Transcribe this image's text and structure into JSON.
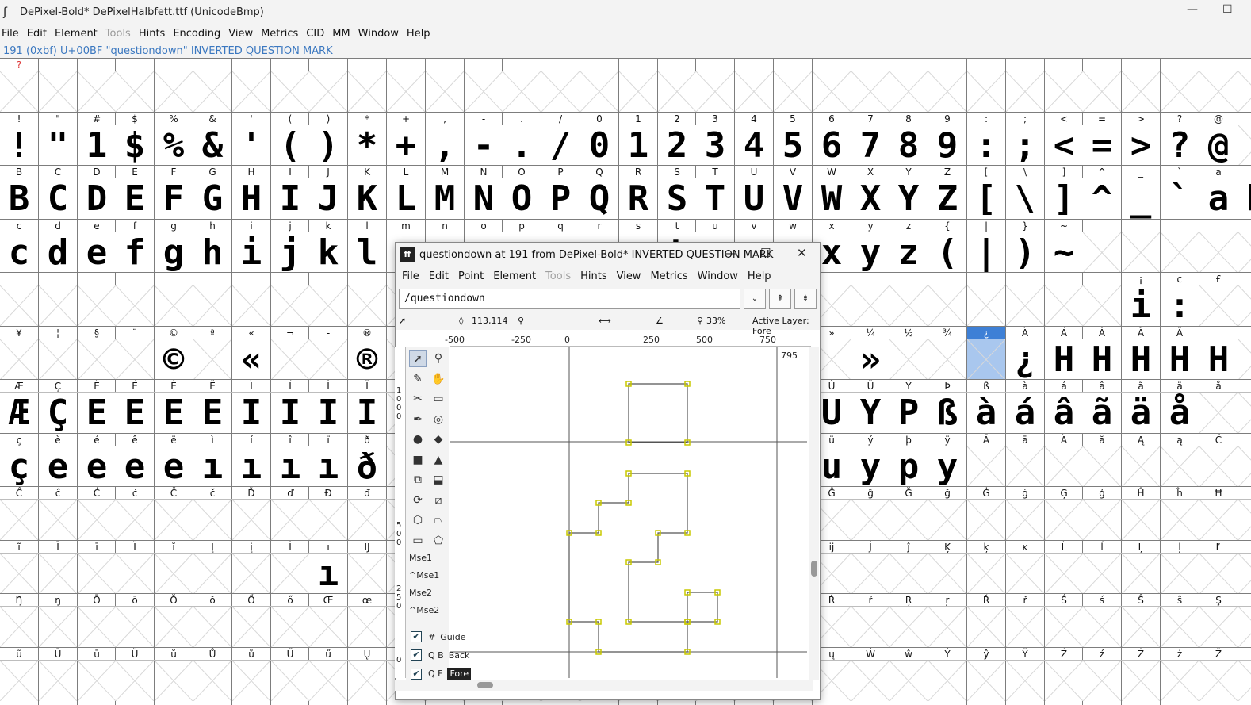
{
  "window": {
    "title": "DePixel-Bold*  DePixelHalbfett.ttf (UnicodeBmp)",
    "app_icon": "fontforge-icon"
  },
  "menu": [
    "File",
    "Edit",
    "Element",
    "Tools",
    "Hints",
    "Encoding",
    "View",
    "Metrics",
    "CID",
    "MM",
    "Window",
    "Help"
  ],
  "menu_disabled": [
    "Tools"
  ],
  "info_line": "191 (0xbf) U+00BF \"questiondown\" INVERTED QUESTION MARK",
  "grid": {
    "rows": [
      {
        "labels": [
          "?",
          "",
          "",
          "",
          "",
          "",
          "",
          "",
          "",
          "",
          "",
          "",
          "",
          "",
          "",
          "",
          "",
          "",
          "",
          "",
          "",
          "",
          "",
          "",
          "",
          "",
          "",
          "",
          "",
          "",
          "",
          "",
          ""
        ],
        "glyphs": [
          "",
          "",
          "",
          "",
          "",
          "",
          "",
          "",
          "",
          "",
          "",
          "",
          "",
          "",
          "",
          "",
          "",
          "",
          "",
          "",
          "",
          "",
          "",
          "",
          "",
          "",
          "",
          "",
          "",
          "",
          "",
          "",
          ""
        ]
      },
      {
        "labels": [
          "!",
          "\"",
          "#",
          "$",
          "%",
          "&",
          "'",
          "(",
          ")",
          "*",
          "+",
          ",",
          "-",
          ".",
          "/",
          "0",
          "1",
          "2",
          "3",
          "4",
          "5",
          "6",
          "7",
          "8",
          "9",
          ":",
          ";",
          "<",
          "=",
          ">",
          "?",
          "@",
          ""
        ],
        "glyphs": [
          "!",
          "\"",
          "1",
          "$",
          "%",
          "&",
          "'",
          "(",
          ")",
          "*",
          "+",
          ",",
          "-",
          ".",
          "/",
          "0",
          "1",
          "2",
          "3",
          "4",
          "5",
          "6",
          "7",
          "8",
          "9",
          ":",
          ";",
          "<",
          "=",
          ">",
          "?",
          "@",
          ""
        ]
      },
      {
        "labels": [
          "B",
          "C",
          "D",
          "E",
          "F",
          "G",
          "H",
          "I",
          "J",
          "K",
          "L",
          "M",
          "N",
          "O",
          "P",
          "Q",
          "R",
          "S",
          "T",
          "U",
          "V",
          "W",
          "X",
          "Y",
          "Z",
          "[",
          "\\",
          "]",
          "^",
          "_",
          "`",
          "a",
          ""
        ],
        "glyphs": [
          "B",
          "C",
          "D",
          "E",
          "F",
          "G",
          "H",
          "I",
          "J",
          "K",
          "L",
          "M",
          "N",
          "O",
          "P",
          "Q",
          "R",
          "S",
          "T",
          "U",
          "V",
          "W",
          "X",
          "Y",
          "Z",
          "[",
          "\\",
          "]",
          "^",
          "_",
          "`",
          "a",
          "b"
        ]
      },
      {
        "labels": [
          "c",
          "d",
          "e",
          "f",
          "g",
          "h",
          "i",
          "j",
          "k",
          "l",
          "m",
          "n",
          "o",
          "p",
          "q",
          "r",
          "s",
          "t",
          "u",
          "v",
          "w",
          "x",
          "y",
          "z",
          "{",
          "|",
          "}",
          "~",
          "",
          "",
          "",
          "",
          ""
        ],
        "glyphs": [
          "c",
          "d",
          "e",
          "f",
          "g",
          "h",
          "i",
          "j",
          "k",
          "l",
          "m",
          "n",
          "o",
          "p",
          "q",
          "r",
          "s",
          "t",
          "u",
          "v",
          "w",
          "x",
          "y",
          "z",
          "(",
          "|",
          ")",
          "~",
          "",
          "",
          "",
          "",
          ""
        ]
      },
      {
        "labels": [
          "",
          "",
          "",
          "",
          "",
          "",
          "",
          "",
          "",
          "",
          "",
          "",
          "",
          "",
          "",
          "",
          "",
          "",
          "",
          "",
          "",
          "",
          "",
          "",
          "",
          "",
          "",
          "",
          "",
          "¡",
          "¢",
          "£",
          ""
        ],
        "glyphs": [
          "",
          "",
          "",
          "",
          "",
          "",
          "",
          "",
          "",
          "",
          "",
          "",
          "",
          "",
          "",
          "",
          "",
          "",
          "",
          "",
          "",
          "",
          "",
          "",
          "",
          "",
          "",
          "",
          "",
          "i",
          ":",
          "",
          ""
        ]
      },
      {
        "labels": [
          "¥",
          "¦",
          "§",
          "¨",
          "©",
          "ª",
          "«",
          "¬",
          "-",
          "®",
          "",
          "",
          "",
          "",
          "",
          "",
          "",
          "",
          "",
          "",
          "",
          "»",
          "¼",
          "½",
          "¾",
          "¿",
          "À",
          "Á",
          "Â",
          "Ã",
          "Ä",
          ""
        ],
        "glyphs": [
          "",
          "",
          "",
          "",
          "©",
          "",
          "«",
          "",
          "",
          "®",
          "",
          "",
          "",
          "",
          "",
          "",
          "",
          "",
          "",
          "",
          "",
          "",
          "»",
          "",
          "",
          "",
          "¿",
          "H",
          "H",
          "H",
          "H",
          "H"
        ]
      },
      {
        "labels": [
          "Æ",
          "Ç",
          "È",
          "É",
          "Ê",
          "Ë",
          "Ì",
          "Í",
          "Î",
          "Ï",
          "",
          "",
          "",
          "",
          "",
          "",
          "",
          "",
          "",
          "",
          "",
          "Û",
          "Ü",
          "Ý",
          "Þ",
          "ß",
          "à",
          "á",
          "â",
          "ã",
          "ä",
          "å"
        ],
        "glyphs": [
          "Æ",
          "Ç",
          "E",
          "E",
          "E",
          "E",
          "I",
          "I",
          "I",
          "I",
          "",
          "",
          "",
          "",
          "",
          "",
          "",
          "",
          "",
          "",
          "",
          "U",
          "Y",
          "P",
          "ß",
          "à",
          "á",
          "â",
          "ã",
          "ä",
          "å",
          ""
        ]
      },
      {
        "labels": [
          "ç",
          "è",
          "é",
          "ê",
          "ë",
          "ì",
          "í",
          "î",
          "ï",
          "ð",
          "",
          "",
          "",
          "",
          "",
          "",
          "",
          "",
          "",
          "",
          "",
          "ü",
          "ý",
          "þ",
          "ÿ",
          "Ā",
          "ā",
          "Ă",
          "ă",
          "Ą",
          "ą",
          "Ć"
        ],
        "glyphs": [
          "ç",
          "e",
          "e",
          "e",
          "e",
          "ı",
          "ı",
          "ı",
          "ı",
          "ð",
          "",
          "",
          "",
          "",
          "",
          "",
          "",
          "",
          "",
          "",
          "",
          "u",
          "y",
          "p",
          "y",
          "",
          "",
          "",
          "",
          "",
          "",
          ""
        ]
      },
      {
        "labels": [
          "Ĉ",
          "ĉ",
          "Ċ",
          "ċ",
          "Č",
          "č",
          "Ď",
          "ď",
          "Đ",
          "đ",
          "",
          "",
          "",
          "",
          "",
          "",
          "",
          "",
          "",
          "",
          "",
          "Ĝ",
          "ĝ",
          "Ğ",
          "ğ",
          "Ġ",
          "ġ",
          "Ģ",
          "ģ",
          "Ĥ",
          "ĥ",
          "Ħ",
          "ħ"
        ],
        "glyphs": [
          "",
          "",
          "",
          "",
          "",
          "",
          "",
          "",
          "",
          "",
          "",
          "",
          "",
          "",
          "",
          "",
          "",
          "",
          "",
          "",
          "",
          "",
          "",
          "",
          "",
          "",
          "",
          "",
          "",
          "",
          "",
          "",
          ""
        ]
      },
      {
        "labels": [
          "ĩ",
          "Ī",
          "ī",
          "Ĭ",
          "ĭ",
          "Į",
          "į",
          "İ",
          "ı",
          "Ĳ",
          "",
          "",
          "",
          "",
          "",
          "",
          "",
          "",
          "",
          "",
          "",
          "ĳ",
          "Ĵ",
          "ĵ",
          "Ķ",
          "ķ",
          "ĸ",
          "Ĺ",
          "ĺ",
          "Ļ",
          "ļ",
          "Ľ",
          "ľ"
        ],
        "glyphs": [
          "",
          "",
          "",
          "",
          "",
          "",
          "",
          "",
          "ı",
          "",
          "",
          "",
          "",
          "",
          "",
          "",
          "",
          "",
          "",
          "",
          "",
          "",
          "",
          "",
          "",
          "",
          "",
          "",
          "",
          "",
          "",
          "",
          ""
        ]
      },
      {
        "labels": [
          "Ŋ",
          "ŋ",
          "Ō",
          "ō",
          "Ŏ",
          "ŏ",
          "Ő",
          "ő",
          "Œ",
          "œ",
          "",
          "",
          "",
          "",
          "",
          "",
          "",
          "",
          "",
          "",
          "",
          "Ŕ",
          "ŕ",
          "Ŗ",
          "ŗ",
          "Ř",
          "ř",
          "Ś",
          "ś",
          "Ŝ",
          "ŝ",
          "Ş",
          "ş"
        ],
        "glyphs": [
          "",
          "",
          "",
          "",
          "",
          "",
          "",
          "",
          "",
          "",
          "",
          "",
          "",
          "",
          "",
          "",
          "",
          "",
          "",
          "",
          "",
          "",
          "",
          "",
          "",
          "",
          "",
          "",
          "",
          "",
          "",
          "",
          ""
        ]
      },
      {
        "labels": [
          "ũ",
          "Ū",
          "ū",
          "Ŭ",
          "ŭ",
          "Ů",
          "ů",
          "Ű",
          "ű",
          "Ų",
          "",
          "",
          "",
          "",
          "",
          "",
          "",
          "",
          "",
          "",
          "",
          "ų",
          "Ŵ",
          "ŵ",
          "Ŷ",
          "ŷ",
          "Ÿ",
          "Ź",
          "ź",
          "Ż",
          "ż",
          "Ž",
          "ž"
        ],
        "glyphs": [
          "",
          "",
          "",
          "",
          "",
          "",
          "",
          "",
          "",
          "",
          "",
          "",
          "",
          "",
          "",
          "",
          "",
          "",
          "",
          "",
          "",
          "",
          "",
          "",
          "",
          "",
          "",
          "",
          "",
          "",
          "",
          "",
          ""
        ]
      }
    ],
    "selected_label": "¿"
  },
  "dialog": {
    "title": "questiondown at 191 from DePixel-Bold* INVERTED QUESTION MARK",
    "logo": "fontforge-logo",
    "menu": [
      "File",
      "Edit",
      "Point",
      "Element",
      "Tools",
      "Hints",
      "View",
      "Metrics",
      "Window",
      "Help"
    ],
    "menu_disabled": [
      "Tools"
    ],
    "glyph_name": "/questiondown",
    "status": {
      "coords": "113,114",
      "zoom": "33%",
      "active_layer": "Active Layer: Fore"
    },
    "ruler_ticks": [
      "-500",
      "-250",
      "0",
      "250",
      "500",
      "750"
    ],
    "vruler_ticks": [
      "1000",
      "500",
      "250",
      "0"
    ],
    "advance_width": "795",
    "mouse_labels": [
      "Mse1",
      "^Mse1",
      "Mse2",
      "^Mse2"
    ],
    "layers": [
      {
        "prefix": "#",
        "name": "Guide",
        "checked": true
      },
      {
        "prefix": "Q B",
        "name": "Back",
        "checked": true
      },
      {
        "prefix": "Q F",
        "name": "Fore",
        "checked": true
      }
    ]
  },
  "colors": {
    "accent": "#3e80d6",
    "point": "#c8c800",
    "info_text": "#3b78c0"
  }
}
